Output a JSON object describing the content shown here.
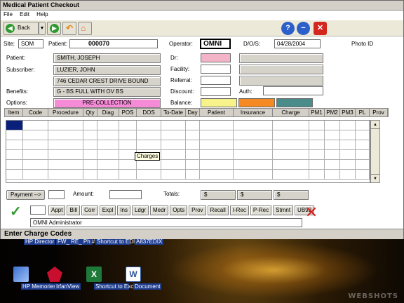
{
  "window": {
    "title": "Medical Patient Checkout"
  },
  "menu": [
    "File",
    "Edit",
    "Help"
  ],
  "toolbar": {
    "back_label": "Back"
  },
  "header": {
    "site_label": "Site:",
    "site_value": "SOM",
    "patient_label": "Patient:",
    "patient_value": "000070",
    "operator_label": "Operator:",
    "operator_value": "OMNI",
    "dos_label": "D/O/S:",
    "dos_value": "04/28/2004",
    "photo_label": "Photo ID"
  },
  "left": {
    "patient_label": "Patient:",
    "patient_value": "SMITH, JOSEPH",
    "subscriber_label": "Subscriber:",
    "subscriber_value": "LUZIER, JOHN",
    "address_value": "746 CEDAR CREST DRIVE BOUND",
    "benefits_label": "Benefits:",
    "benefits_value": "G - BS FULL WITH OV BS",
    "options_label": "Options:",
    "options_value": "PRE-COLLECTION"
  },
  "middle": {
    "dr_label": "Dr:",
    "facility_label": "Facility:",
    "referral_label": "Referral:",
    "discount_label": "Discount:",
    "auth_label": "Auth:",
    "balance_label": "Balance:"
  },
  "grid": {
    "columns": [
      "Item",
      "Code",
      "Procedure",
      "Qty",
      "Diag",
      "POS",
      "DOS",
      "To-Date",
      "Day",
      "Patient",
      "Insurance",
      "Charge",
      "PM1",
      "PM2",
      "PM3",
      "PL",
      "Prov"
    ],
    "tooltip": "Charges"
  },
  "payment": {
    "payment_button": "Payment -->",
    "amount_label": "Amount:",
    "totals_label": "Totals:",
    "total1": "$",
    "total2": "$",
    "total3": "$"
  },
  "actions": [
    "Appt",
    "Bill",
    "Corr",
    "Expl",
    "Ins",
    "Ldgr",
    "Medr",
    "Opts",
    "Prov",
    "Recall",
    "I-Rec",
    "P-Rec",
    "Stmnt",
    "UB92"
  ],
  "user_field": "OMNI Administrator",
  "status_text": "Enter Charge Codes",
  "colors": {
    "dr_field": "#f4b4c8",
    "options_field": "#f58ad6",
    "balance_yellow": "#f7f28a",
    "balance_orange": "#f58a22",
    "balance_teal": "#4a8c8a"
  },
  "desktop": {
    "icons": [
      {
        "label": "HP Director",
        "icon": "hp-director-icon"
      },
      {
        "label": "FW_ RE_ Ph # Change",
        "icon": "email-message-icon"
      },
      {
        "label": "Shortcut to EDI Con...",
        "icon": "shortcut-icon"
      },
      {
        "label": "A837EDIX",
        "icon": "file-icon"
      },
      {
        "label": "HP Memories Disc",
        "icon": "hp-memories-icon"
      },
      {
        "label": "IrfanView",
        "icon": "irfanview-icon"
      },
      {
        "label": "Shortcut to Excel",
        "icon": "excel-icon"
      },
      {
        "label": "Document",
        "icon": "word-document-icon"
      }
    ],
    "watermark": "WEBSHOTS"
  }
}
